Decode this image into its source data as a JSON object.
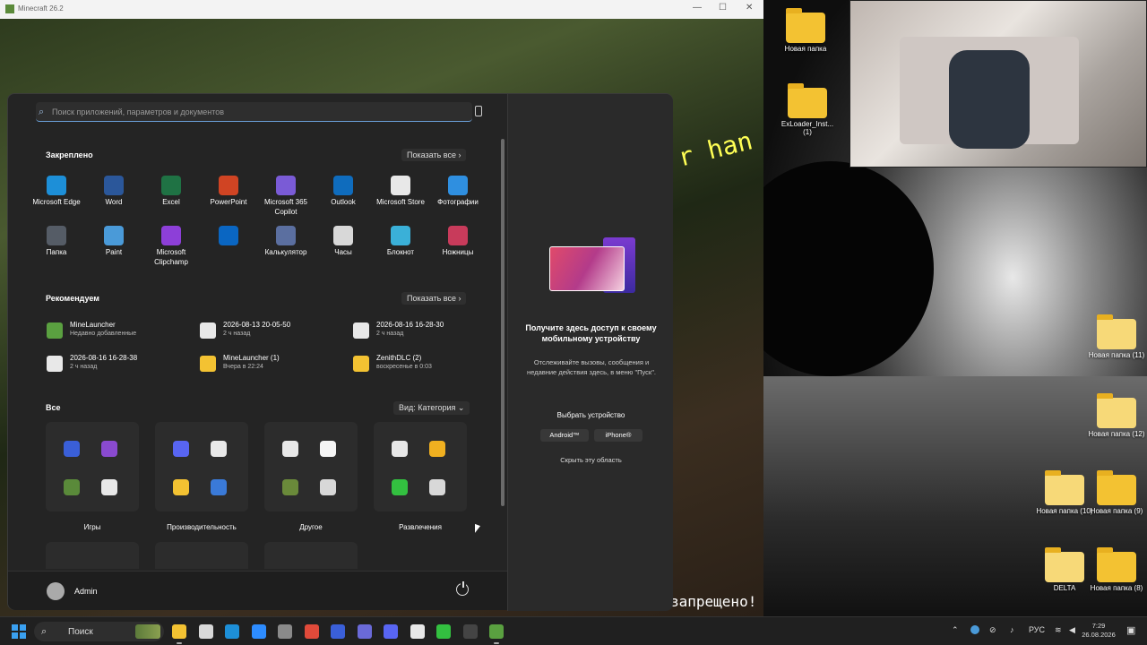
{
  "minecraft_window": {
    "title": "Minecraft 26.2",
    "hint_text": "r han",
    "bottom_text": "запрещено!"
  },
  "start_menu": {
    "search_placeholder": "Поиск приложений, параметров и документов",
    "pinned": {
      "title": "Закреплено",
      "show_all": "Показать все ›",
      "apps": [
        {
          "label": "Microsoft Edge",
          "icon": "edge-icon",
          "color": "#1d8fd8"
        },
        {
          "label": "Word",
          "icon": "word-icon",
          "color": "#2b579a"
        },
        {
          "label": "Excel",
          "icon": "excel-icon",
          "color": "#1f7244"
        },
        {
          "label": "PowerPoint",
          "icon": "powerpoint-icon",
          "color": "#d04423"
        },
        {
          "label": "Microsoft 365 Copilot",
          "icon": "copilot-icon",
          "color": "#7a5bd6"
        },
        {
          "label": "Outlook",
          "icon": "outlook-icon",
          "color": "#0f6cbd"
        },
        {
          "label": "Microsoft Store",
          "icon": "store-icon",
          "color": "#e8e8e8"
        },
        {
          "label": "Фотографии",
          "icon": "photos-icon",
          "color": "#2f8fe0"
        },
        {
          "label": "Папка",
          "icon": "folder-icon",
          "color": "#555c66"
        },
        {
          "label": "Paint",
          "icon": "paint-icon",
          "color": "#4a9ad8"
        },
        {
          "label": "Microsoft Clipchamp",
          "icon": "clipchamp-icon",
          "color": "#8d3fd8"
        },
        {
          "label": "",
          "icon": "linkedin-icon",
          "color": "#0a66c2"
        },
        {
          "label": "Калькулятор",
          "icon": "calculator-icon",
          "color": "#5b6fa0"
        },
        {
          "label": "Часы",
          "icon": "clock-icon",
          "color": "#d8d8d8"
        },
        {
          "label": "Блокнот",
          "icon": "notepad-icon",
          "color": "#3ab0d8"
        },
        {
          "label": "Ножницы",
          "icon": "scissors-icon",
          "color": "#c83b5b"
        }
      ]
    },
    "recommended": {
      "title": "Рекомендуем",
      "show_all": "Показать все ›",
      "items": [
        {
          "name": "MineLauncher",
          "time": "Недавно добавленные",
          "icon": "minelauncher-icon",
          "color": "#5aa040"
        },
        {
          "name": "2026-08-13 20-05-50",
          "time": "2 ч назад",
          "icon": "video-file-icon",
          "color": "#e8e8e8"
        },
        {
          "name": "2026-08-16 16-28-30",
          "time": "2 ч назад",
          "icon": "video-file-icon",
          "color": "#e8e8e8"
        },
        {
          "name": "2026-08-16 16-28-38",
          "time": "2 ч назад",
          "icon": "video-file-icon",
          "color": "#e8e8e8"
        },
        {
          "name": "MineLauncher (1)",
          "time": "Вчера в 22:24",
          "icon": "folder-icon",
          "color": "#f3c232"
        },
        {
          "name": "ZenithDLC (2)",
          "time": "воскресенье в 0:03",
          "icon": "folder-icon",
          "color": "#f3c232"
        }
      ]
    },
    "all": {
      "title": "Все",
      "view": "Вид: Категория ⌄",
      "categories": [
        {
          "label": "Игры",
          "icons": [
            "#3a5fd8",
            "#8a4ad0",
            "#5a8a3a",
            "#e8e8e8"
          ]
        },
        {
          "label": "Производительность",
          "icons": [
            "#5865f2",
            "#e8e8e8",
            "#f3c232",
            "#3a7ad8"
          ]
        },
        {
          "label": "Другое",
          "icons": [
            "#e8e8e8",
            "#f5f5f5",
            "#6a8a3a",
            "#d8d8d8"
          ]
        },
        {
          "label": "Развлечения",
          "icons": [
            "#e8e8e8",
            "#f0b020",
            "#33c040",
            "#d8d8d8"
          ]
        }
      ]
    },
    "user": {
      "name": "Admin"
    }
  },
  "phone_link": {
    "title": "Получите здесь доступ к своему мобильному устройству",
    "description": "Отслеживайте вызовы, сообщения и недавние действия здесь, в меню \"Пуск\".",
    "choose": "Выбрать устройство",
    "android": "Android™",
    "iphone": "iPhone®",
    "hide": "Скрыть эту область"
  },
  "desktop_icons": [
    {
      "label": "Новая папка"
    },
    {
      "label": "ExLoader_Inst... (1)"
    },
    {
      "label": "Новая папка (11)"
    },
    {
      "label": "Новая папка (12)"
    },
    {
      "label": "Новая папка (10)"
    },
    {
      "label": "Новая папка (9)"
    },
    {
      "label": "DELTA"
    },
    {
      "label": "Новая папка (8)"
    }
  ],
  "taskbar": {
    "search_label": "Поиск",
    "language": "РУС",
    "time": "7:29",
    "date": "26.08.2026",
    "apps": [
      {
        "icon": "file-explorer-icon",
        "color": "#f3c232"
      },
      {
        "icon": "store-icon",
        "color": "#d8d8d8"
      },
      {
        "icon": "edge-icon",
        "color": "#1d8fd8"
      },
      {
        "icon": "zoom-icon",
        "color": "#2d8cff"
      },
      {
        "icon": "settings-icon",
        "color": "#8a8a8a"
      },
      {
        "icon": "chrome-icon",
        "color": "#e04a3a"
      },
      {
        "icon": "app-icon",
        "color": "#3a5fd8"
      },
      {
        "icon": "gamepad-icon",
        "color": "#6a6ad8"
      },
      {
        "icon": "discord-icon",
        "color": "#5865f2"
      },
      {
        "icon": "yandex-icon",
        "color": "#e8e8e8"
      },
      {
        "icon": "xbox-icon",
        "color": "#33c040"
      },
      {
        "icon": "obs-icon",
        "color": "#444"
      },
      {
        "icon": "minecraft-icon",
        "color": "#5aa040"
      }
    ]
  }
}
